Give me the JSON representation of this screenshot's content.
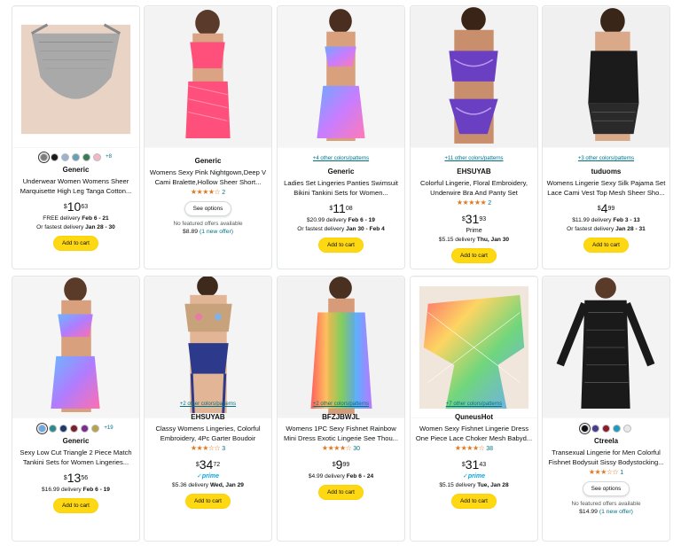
{
  "products": [
    {
      "brand": "Generic",
      "title": "Underwear Women Womens Sheer Marquisette High Leg Tanga Cotton...",
      "swatches": [
        "#7d7d7d",
        "#1a1a1a",
        "#9bb3cc",
        "#6b9fb5",
        "#3b7a57",
        "#f2b8c6"
      ],
      "more_colors": "+8",
      "price": {
        "cur": "$",
        "whole": "10",
        "frac": "63"
      },
      "delivery1": "FREE delivery ",
      "delivery1_date": "Feb 6 - 21",
      "delivery2": "Or fastest delivery ",
      "delivery2_date": "Jan 28 - 30",
      "cart": "Add to cart",
      "image_desc": "gray-underwear"
    },
    {
      "brand": "Generic",
      "title": "Womens Sexy Pink Nightgown,Deep V Cami Bralette,Hollow Sheer Short...",
      "stars": "★★★★☆",
      "rating_count": "2",
      "options": "See options",
      "nofeat": "No featured offers available",
      "offer_price": "$8.89",
      "offer_link": "(1 new offer)",
      "image_desc": "pink-fishnet"
    },
    {
      "colors_link": "+4 other colors/patterns",
      "brand": "Generic",
      "title": "Ladies Set Lingeries Panties Swimsuit Bikini Tankini Sets for Women...",
      "price": {
        "cur": "$",
        "whole": "11",
        "frac": "08"
      },
      "delivery1": "$20.99 delivery ",
      "delivery1_date": "Feb 6 - 19",
      "delivery2": "Or fastest delivery ",
      "delivery2_date": "Jan 30 - Feb 4",
      "cart": "Add to cart",
      "image_desc": "tie-dye-bikini"
    },
    {
      "colors_link": "+11 other colors/patterns",
      "brand": "EHSUYAB",
      "title": "Colorful Lingerie, Floral Embroidery, Underwire Bra And Panty Set",
      "stars": "★★★★★",
      "rating_count": "2",
      "price": {
        "cur": "$",
        "whole": "31",
        "frac": "93"
      },
      "prime_text": "Prime",
      "delivery1": "$5.15 delivery ",
      "delivery1_date": "Thu, Jan 30",
      "cart": "Add to cart",
      "image_desc": "purple-lace-set"
    },
    {
      "colors_link": "+3 other colors/patterns",
      "brand": "tuduoms",
      "title": "Womens Lingerie Sexy Silk Pajama Set Lace Cami Vest Top Mesh Sheer Sho...",
      "price": {
        "cur": "$",
        "whole": "4",
        "frac": "99"
      },
      "delivery1": "$11.99 delivery ",
      "delivery1_date": "Feb 3 - 13",
      "delivery2": "Or fastest delivery ",
      "delivery2_date": "Jan 28 - 31",
      "cart": "Add to cart",
      "image_desc": "black-silk-lace"
    },
    {
      "swatches": [
        "#6aa9e8",
        "#2e8b8b",
        "#1e3a6b",
        "#7a1f2b",
        "#7b2d8e",
        "#b8a24a"
      ],
      "more_colors": "+19",
      "brand": "Generic",
      "title": "Sexy Low Cut Triangle 2 Piece Match Tankini Sets for Women Lingeries...",
      "price": {
        "cur": "$",
        "whole": "13",
        "frac": "56"
      },
      "delivery1": "$16.99 delivery ",
      "delivery1_date": "Feb 6 - 19",
      "cart": "Add to cart",
      "image_desc": "tie-dye-tankini"
    },
    {
      "colors_link": "+2 other colors/patterns",
      "brand": "EHSUYAB",
      "title": "Classy Womens Lingeries, Colorful Embroidery, 4Pc Garter Boudoir",
      "stars": "★★★☆☆",
      "rating_count": "3",
      "price": {
        "cur": "$",
        "whole": "34",
        "frac": "72"
      },
      "prime_text": "prime",
      "delivery1": "$5.36 delivery ",
      "delivery1_date": "Wed, Jan 29",
      "cart": "Add to cart",
      "image_desc": "floral-garter"
    },
    {
      "colors_link": "+2 other colors/patterns",
      "brand": "BFZJBWJL",
      "title": "Womens 1PC Sexy Fishnet Rainbow Mini Dress Exotic Lingerie See Thou...",
      "stars": "★★★★☆",
      "rating_count": "30",
      "price": {
        "cur": "$",
        "whole": "9",
        "frac": "99"
      },
      "delivery1": "$4.99 delivery ",
      "delivery1_date": "Feb 6 - 24",
      "cart": "Add to cart",
      "image_desc": "rainbow-mini-dress"
    },
    {
      "colors_link": "+7 other colors/patterns",
      "brand": "QuneusHot",
      "title": "Women Sexy Fishnet Lingerie Dress One Piece Lace Choker Mesh Babyd...",
      "stars": "★★★★☆",
      "rating_count": "38",
      "price": {
        "cur": "$",
        "whole": "31",
        "frac": "43"
      },
      "prime_text": "prime",
      "delivery1": "$5.15 delivery ",
      "delivery1_date": "Tue, Jan 28",
      "cart": "Add to cart",
      "image_desc": "rainbow-fishnet"
    },
    {
      "swatches": [
        "#111111",
        "#4a3b8f",
        "#8a1c2c",
        "#1f9bbf",
        "#e8e8e8"
      ],
      "brand": "Ctreela",
      "title": "Transexual Lingerie for Men Colorful Fishnet Bodysuit Sissy Bodystocking...",
      "stars": "★★★☆☆",
      "rating_count": "1",
      "options": "See options",
      "nofeat": "No featured offers available",
      "offer_price": "$14.99",
      "offer_link": "(1 new offer)",
      "image_desc": "black-mesh-bodysuit"
    }
  ]
}
